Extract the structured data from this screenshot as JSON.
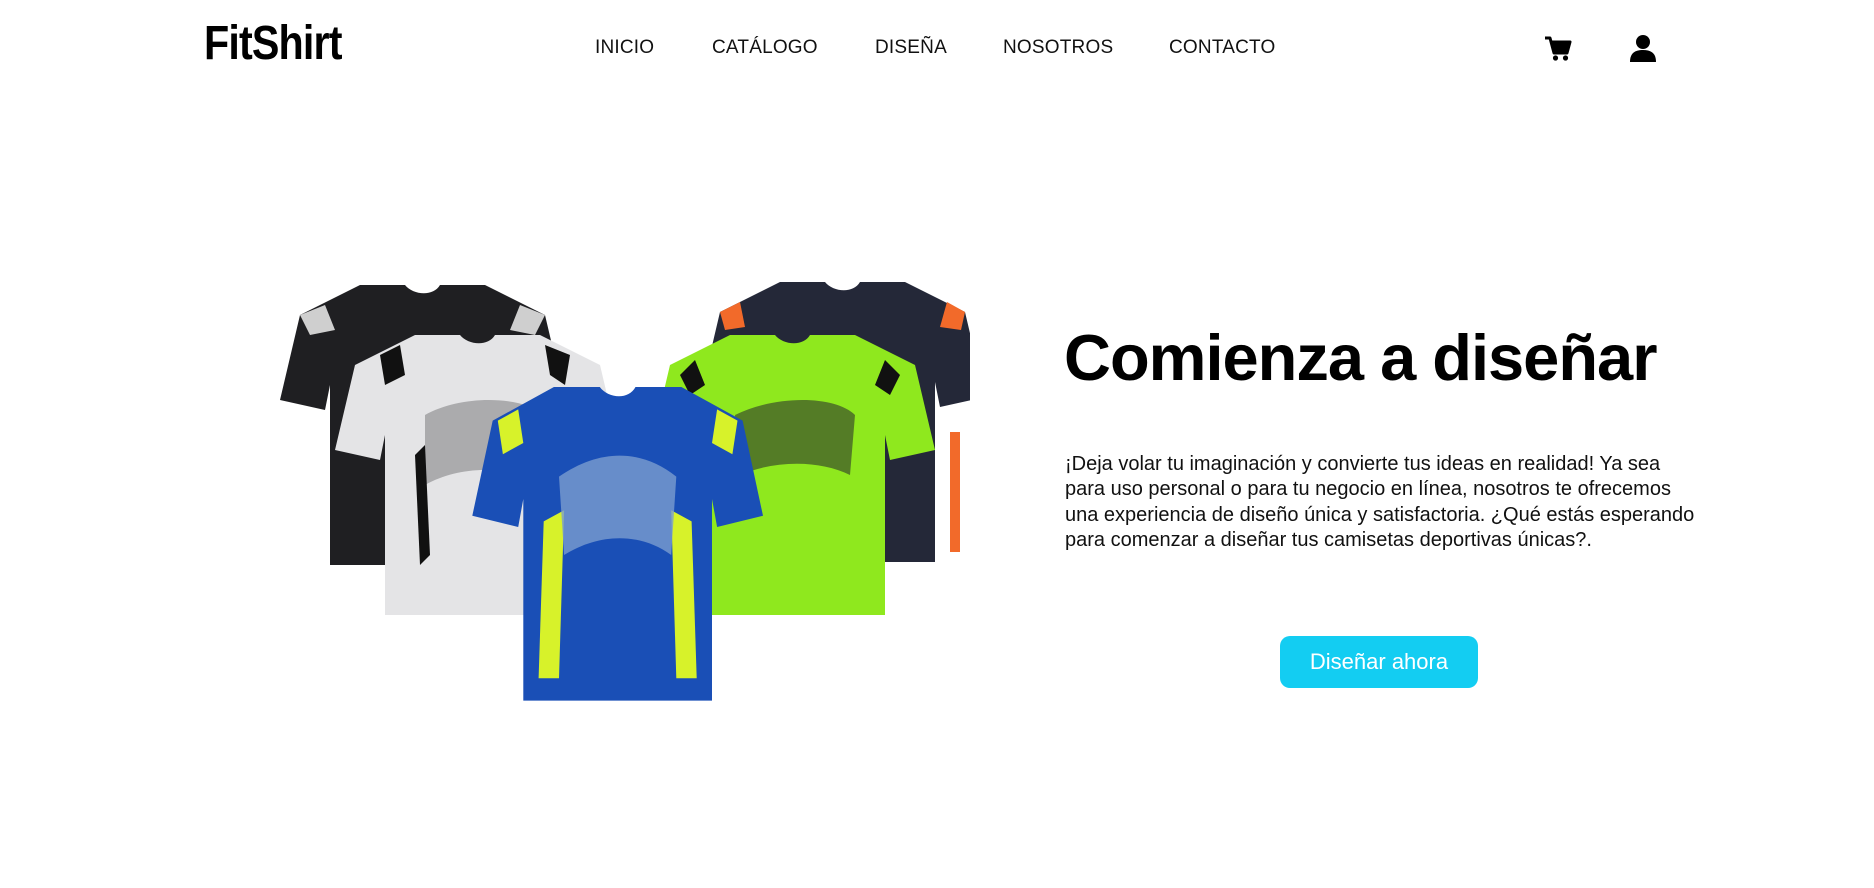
{
  "brand": {
    "name": "FitShirt"
  },
  "nav": {
    "items": [
      "INICIO",
      "CATÁLOGO",
      "DISEÑA",
      "NOSOTROS",
      "CONTACTO"
    ],
    "icons": [
      "cart-icon",
      "user-icon"
    ]
  },
  "hero": {
    "title": "Comienza a diseñar",
    "description": "¡Deja volar tu imaginación y convierte tus ideas en realidad! Ya sea para uso personal o para tu negocio en línea, nosotros te ofrecemos una experiencia de diseño única y satisfactoria. ¿Qué estás esperando para comenzar a diseñar tus camisetas deportivas únicas?.",
    "cta_label": "Diseñar ahora",
    "image": "five-sports-tshirts (black, white, navy, lime, blue)"
  },
  "colors": {
    "accent": "#13cdf2",
    "text": "#000000",
    "background": "#ffffff"
  }
}
